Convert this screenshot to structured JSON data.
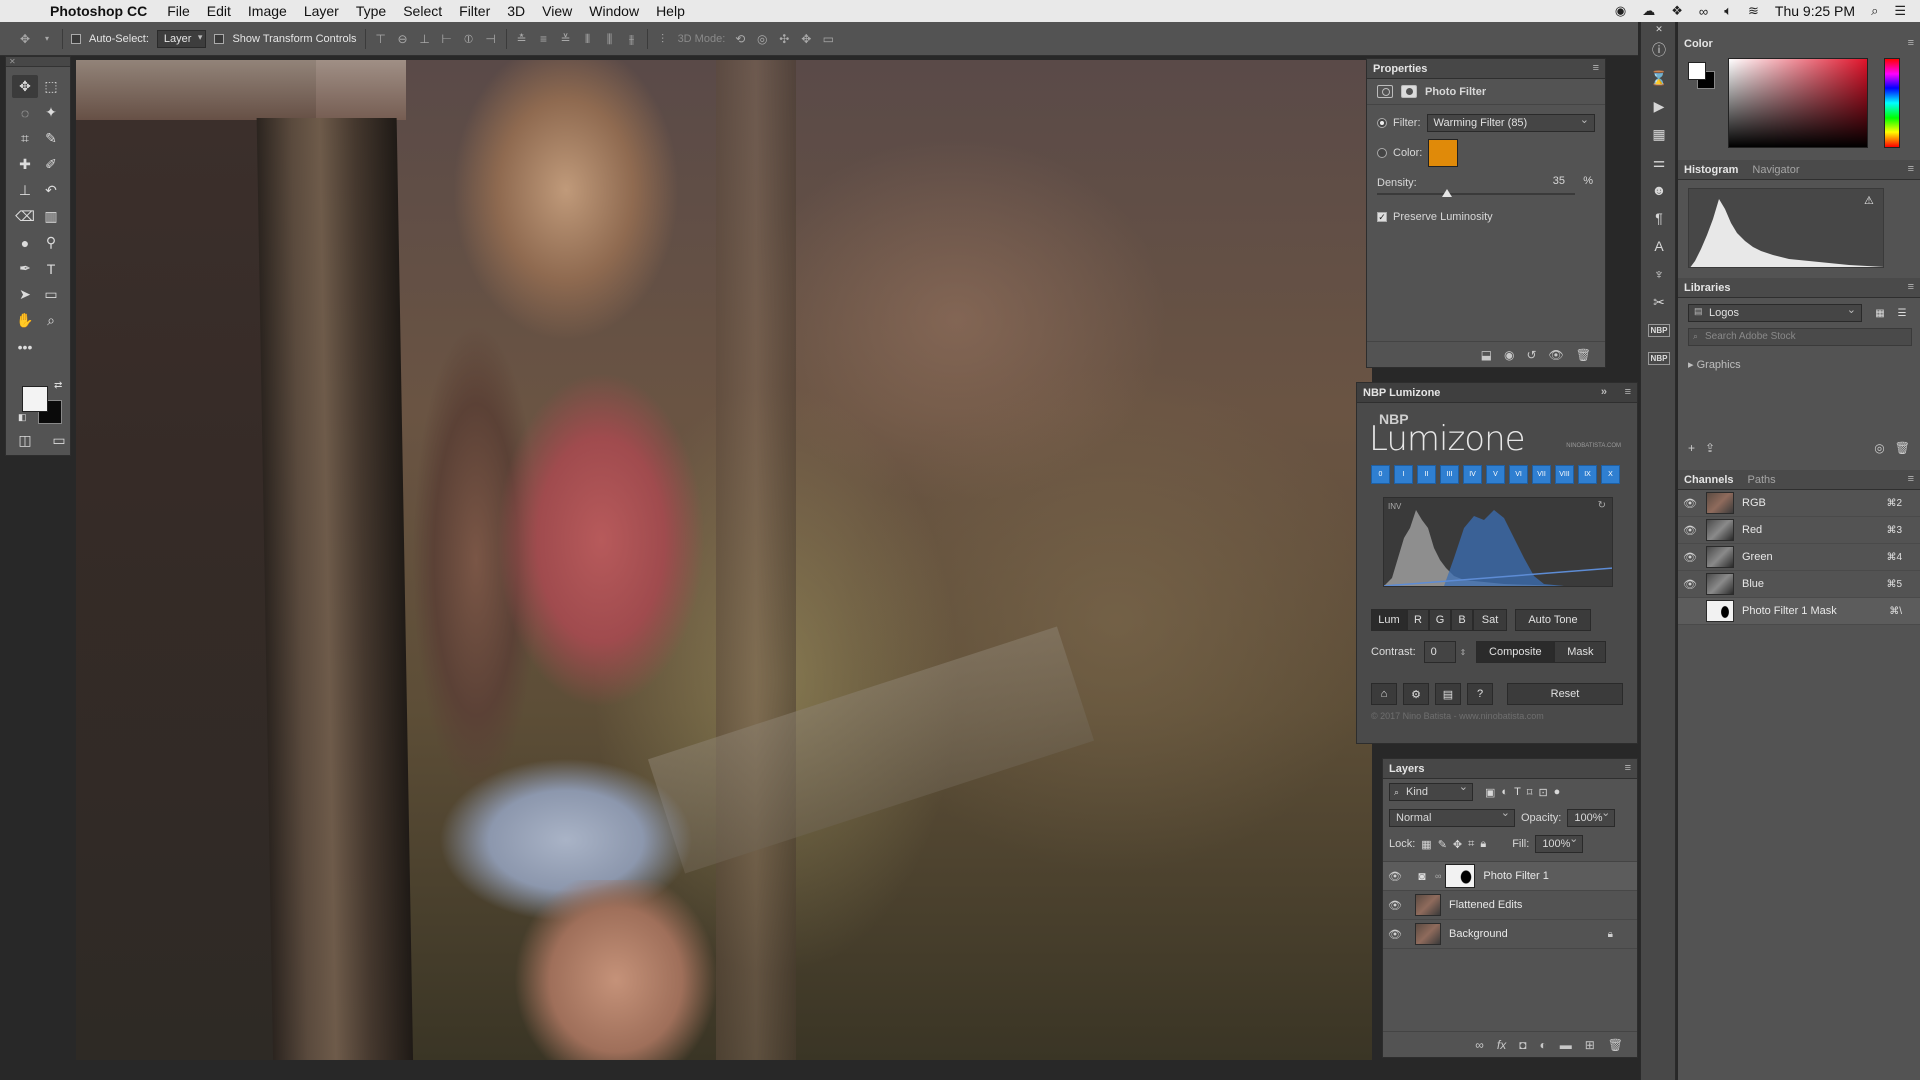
{
  "menubar": {
    "app_name": "Photoshop CC",
    "menus": [
      "File",
      "Edit",
      "Image",
      "Layer",
      "Type",
      "Select",
      "Filter",
      "3D",
      "View",
      "Window",
      "Help"
    ],
    "clock": "Thu 9:25 PM"
  },
  "options_bar": {
    "auto_select_label": "Auto-Select:",
    "auto_select_value": "Layer",
    "show_transform_label": "Show Transform Controls",
    "mode_3d_label": "3D Mode:"
  },
  "properties": {
    "title": "Properties",
    "subtitle": "Photo Filter",
    "filter_label": "Filter:",
    "filter_value": "Warming Filter (85)",
    "color_label": "Color:",
    "color_hex": "#e08a09",
    "density_label": "Density:",
    "density_value": "35",
    "density_unit": "%",
    "density_fraction": 0.35,
    "preserve_label": "Preserve Luminosity"
  },
  "lumizone": {
    "title": "NBP Lumizone",
    "logo_nbp": "NBP",
    "logo_name": "Lumizone",
    "url_small": "NINOBATISTA.COM",
    "zones": [
      "0",
      "I",
      "II",
      "III",
      "IV",
      "V",
      "VI",
      "VII",
      "VIII",
      "IX",
      "X"
    ],
    "inv_label": "INV",
    "channel_buttons": [
      "Lum",
      "R",
      "G",
      "B",
      "Sat"
    ],
    "auto_tone": "Auto Tone",
    "contrast_label": "Contrast:",
    "contrast_value": "0",
    "composite_label": "Composite",
    "mask_label": "Mask",
    "reset_label": "Reset",
    "footer": "© 2017 Nino Batista - www.ninobatista.com"
  },
  "layers": {
    "title": "Layers",
    "kind_label": "Kind",
    "blend_mode": "Normal",
    "opacity_label": "Opacity:",
    "opacity_value": "100%",
    "lock_label": "Lock:",
    "fill_label": "Fill:",
    "fill_value": "100%",
    "items": [
      {
        "name": "Photo Filter 1"
      },
      {
        "name": "Flattened Edits"
      },
      {
        "name": "Background"
      }
    ]
  },
  "color_panel": {
    "title": "Color"
  },
  "histogram_panel": {
    "title": "Histogram",
    "tab2": "Navigator"
  },
  "libraries": {
    "title": "Libraries",
    "library_value": "Logos",
    "search_placeholder": "Search Adobe Stock",
    "graphics_label": "Graphics"
  },
  "channels": {
    "title": "Channels",
    "tab2": "Paths",
    "items": [
      {
        "name": "RGB",
        "key": "⌘2"
      },
      {
        "name": "Red",
        "key": "⌘3"
      },
      {
        "name": "Green",
        "key": "⌘4"
      },
      {
        "name": "Blue",
        "key": "⌘5"
      },
      {
        "name": "Photo Filter 1 Mask",
        "key": "⌘\\"
      }
    ]
  },
  "icon_strip": {
    "nbp_1": "NBP",
    "nbp_2": "NBP"
  }
}
